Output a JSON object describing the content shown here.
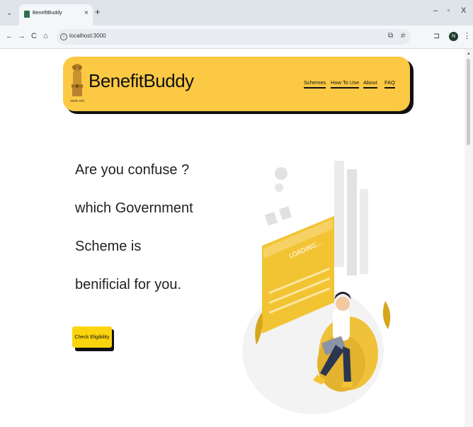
{
  "browser": {
    "tab": {
      "title": "BenefitBuddy",
      "close": "×"
    },
    "new_tab": "+",
    "window": {
      "minimize": "–",
      "maximize": "▫",
      "close": "X"
    },
    "nav": {
      "back": "←",
      "forward": "→",
      "reload": "C",
      "home": "⌂"
    },
    "url": "localhost:3000",
    "profile_initial": "N",
    "menu": "⋮"
  },
  "site": {
    "brand": "BenefitBuddy",
    "emblem_caption": "सत्यमेव जयते",
    "nav": [
      "Schemes",
      "How To Use",
      "About",
      "FAQ"
    ]
  },
  "hero": {
    "lines": [
      "Are you confuse ?",
      "which Government",
      "Scheme is",
      "benificial for you."
    ],
    "cta": "Check Eligibility"
  },
  "illustration": {
    "loading_text": "LOADING..."
  },
  "colors": {
    "header": "#fcc944",
    "accent": "#fcd40e",
    "illustration_yellow": "#f2c433"
  }
}
